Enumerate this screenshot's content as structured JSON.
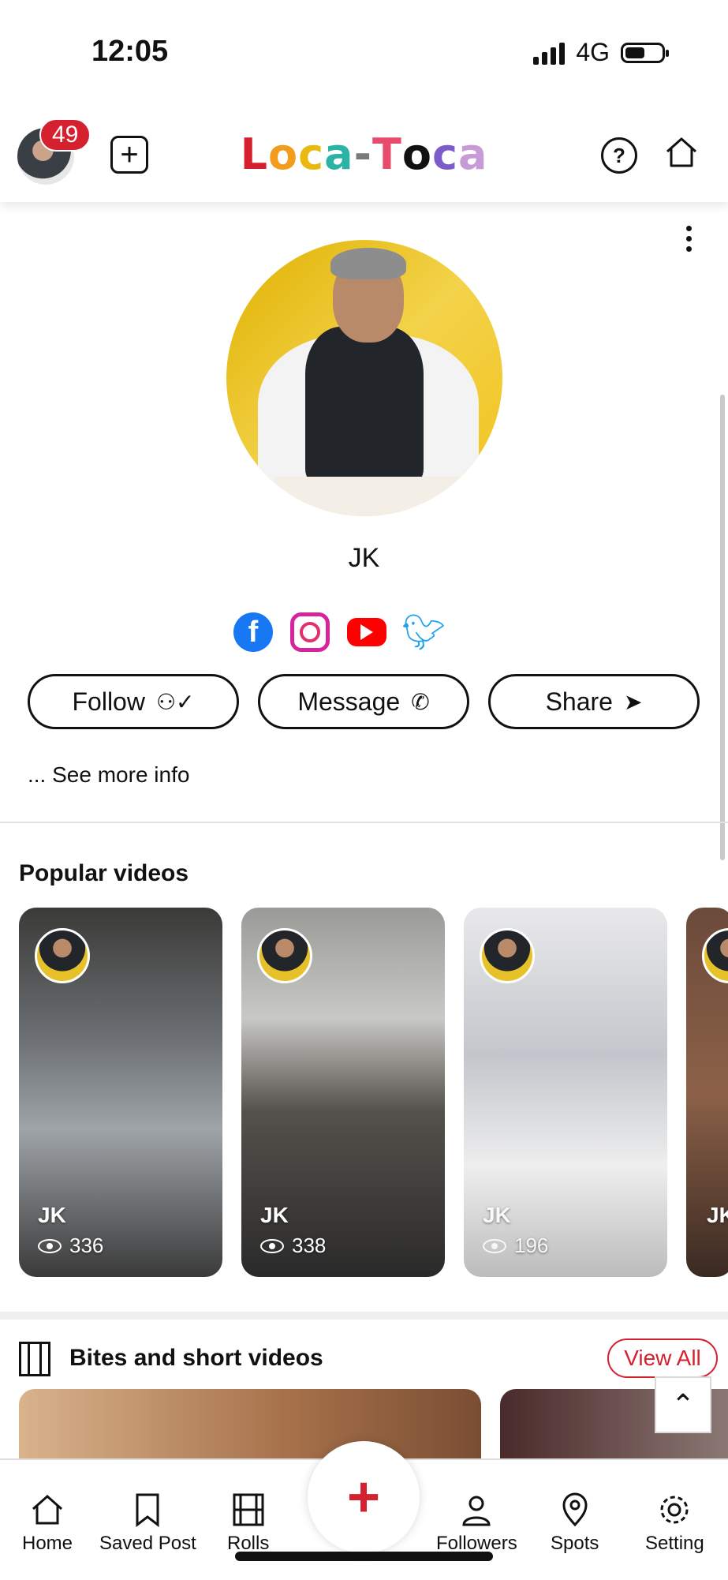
{
  "status": {
    "time": "12:05",
    "network": "4G"
  },
  "header": {
    "notification_count": "49",
    "logo_letters": [
      {
        "ch": "L",
        "color": "#d4202f"
      },
      {
        "ch": "o",
        "color": "#f29b1d"
      },
      {
        "ch": "c",
        "color": "#e8b90f"
      },
      {
        "ch": "a",
        "color": "#2bb3a5"
      },
      {
        "ch": "-",
        "color": "#7a7a7a"
      },
      {
        "ch": "T",
        "color": "#e84b6b"
      },
      {
        "ch": "o",
        "color": "#111111"
      },
      {
        "ch": "c",
        "color": "#7b5cc9"
      },
      {
        "ch": "a",
        "color": "#c79bd6"
      }
    ],
    "help_symbol": "?"
  },
  "profile": {
    "name": "JK",
    "socials": [
      "facebook-icon",
      "instagram-icon",
      "youtube-icon",
      "twitter-icon"
    ],
    "follow_label": "Follow",
    "message_label": "Message",
    "share_label": "Share",
    "see_more": "... See more info"
  },
  "popular": {
    "title": "Popular videos",
    "videos": [
      {
        "name": "JK",
        "views": "336"
      },
      {
        "name": "JK",
        "views": "338"
      },
      {
        "name": "JK",
        "views": "196"
      },
      {
        "name": "JK",
        "views": ""
      }
    ]
  },
  "bites": {
    "title": "Bites and short videos",
    "view_all": "View All"
  },
  "tabs": {
    "home": "Home",
    "saved": "Saved Post",
    "rolls": "Rolls",
    "followers": "Followers",
    "spots": "Spots",
    "setting": "Setting",
    "fab_symbol": "+"
  },
  "colors": {
    "accent": "#d4202f"
  }
}
